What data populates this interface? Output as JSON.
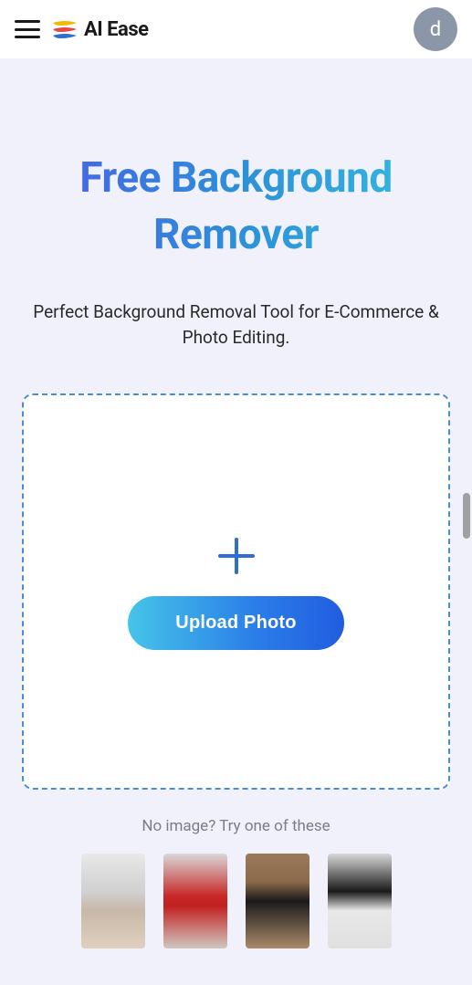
{
  "header": {
    "brand": "AI Ease",
    "avatar_letter": "d"
  },
  "hero": {
    "title": "Free Background Remover",
    "subtitle": "Perfect Background Removal Tool for E-Commerce & Photo Editing."
  },
  "upload": {
    "button_label": "Upload Photo"
  },
  "samples": {
    "label": "No image? Try one of these"
  }
}
